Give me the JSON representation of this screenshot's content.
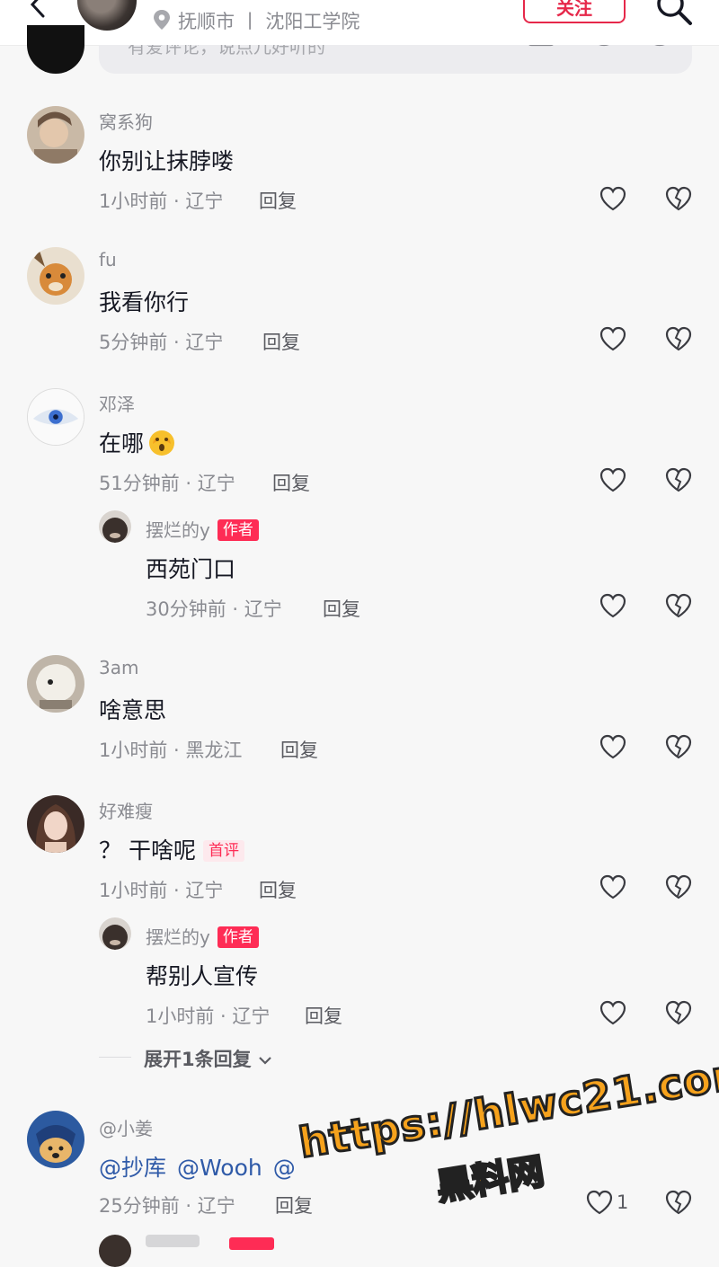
{
  "header": {
    "location_text": "抚顺市 丨 沈阳工学院",
    "follow_label": "关注"
  },
  "composer": {
    "placeholder": "有爱评论，说点儿好听的"
  },
  "comments": [
    {
      "user": "窝系狗",
      "text": "你别让抹脖喽",
      "time_location": "1小时前 · 辽宁",
      "reply_label": "回复"
    },
    {
      "user": "fu",
      "text": "我看你行",
      "time_location": "5分钟前 · 辽宁",
      "reply_label": "回复"
    },
    {
      "user": "邓泽",
      "text": "在哪",
      "time_location": "51分钟前 · 辽宁",
      "reply_label": "回复",
      "replies": [
        {
          "user": "摆烂的y",
          "badge": "作者",
          "text": "西苑门口",
          "time_location": "30分钟前 · 辽宁",
          "reply_label": "回复"
        }
      ]
    },
    {
      "user": "3am",
      "text": "啥意思",
      "time_location": "1小时前 · 黑龙江",
      "reply_label": "回复"
    },
    {
      "user": "好难瘦",
      "text": "？ 干啥呢",
      "badge": "首评",
      "time_location": "1小时前 · 辽宁",
      "reply_label": "回复",
      "replies": [
        {
          "user": "摆烂的y",
          "badge": "作者",
          "text": "帮别人宣传",
          "time_location": "1小时前 · 辽宁",
          "reply_label": "回复"
        }
      ],
      "expand_label": "展开1条回复"
    },
    {
      "user": "@小姜",
      "mentions": [
        "@抄库",
        "@Wooh",
        "@"
      ],
      "time_location": "25分钟前 · 辽宁",
      "reply_label": "回复",
      "like_count": "1"
    }
  ],
  "watermark": {
    "line1": "https://hlwc21.com",
    "line2": "黑料网"
  },
  "colors": {
    "accent": "#fe2c55",
    "mention": "#2f5aa8",
    "meta": "#8a8b91"
  },
  "icons": [
    "back-arrow-icon",
    "location-pin-icon",
    "search-icon",
    "image-icon",
    "at-icon",
    "emoji-icon",
    "heart-icon",
    "broken-heart-icon",
    "chevron-down-icon"
  ]
}
